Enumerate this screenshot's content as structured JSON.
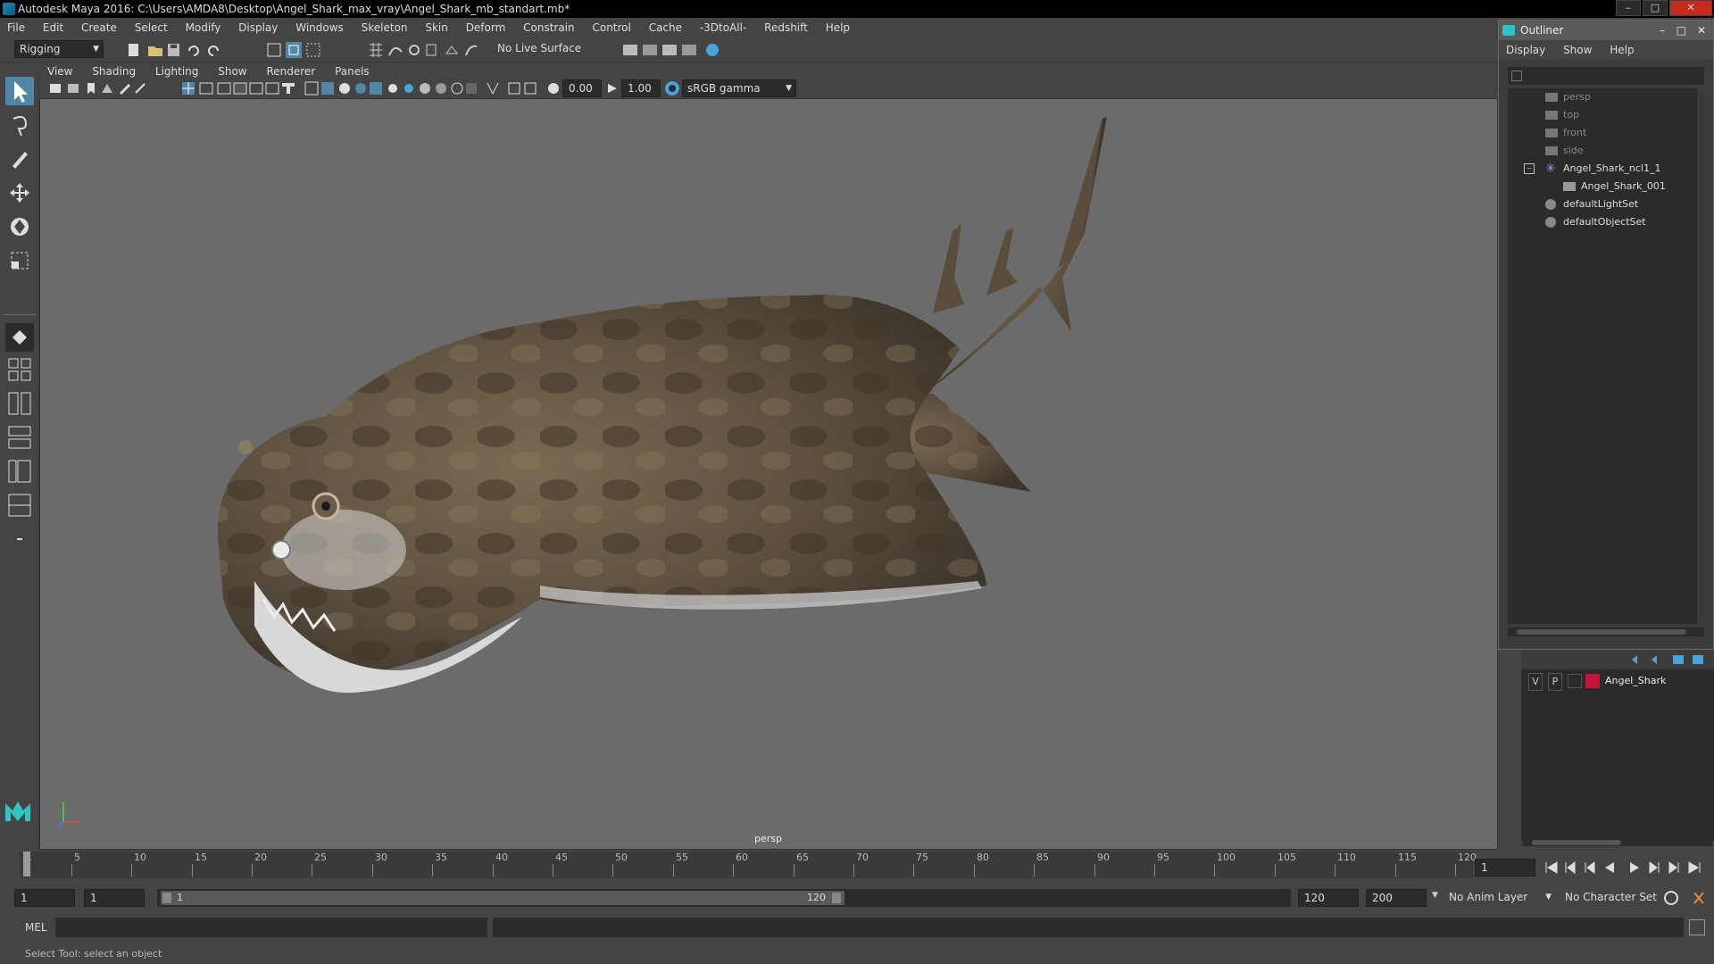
{
  "title_bar": {
    "text": "Autodesk Maya 2016: C:\\Users\\AMDA8\\Desktop\\Angel_Shark_max_vray\\Angel_Shark_mb_standart.mb*",
    "minimize": "–",
    "maximize": "□",
    "close": "✕"
  },
  "menu": [
    "File",
    "Edit",
    "Create",
    "Select",
    "Modify",
    "Display",
    "Windows",
    "Skeleton",
    "Skin",
    "Deform",
    "Constrain",
    "Control",
    "Cache",
    "-3DtoAll-",
    "Redshift",
    "Help"
  ],
  "status_line": {
    "mode": "Rigging",
    "live_surface": "No Live Surface"
  },
  "viewport": {
    "menu": [
      "View",
      "Shading",
      "Lighting",
      "Show",
      "Renderer",
      "Panels"
    ],
    "exposure": "0.00",
    "gamma": "1.00",
    "color_space": "sRGB gamma",
    "camera_label": "persp"
  },
  "outliner": {
    "title": "Outliner",
    "menu": [
      "Display",
      "Show",
      "Help"
    ],
    "items": [
      {
        "label": "persp",
        "kind": "camera",
        "indent": 0
      },
      {
        "label": "top",
        "kind": "camera",
        "indent": 0
      },
      {
        "label": "front",
        "kind": "camera",
        "indent": 0
      },
      {
        "label": "side",
        "kind": "camera",
        "indent": 0
      },
      {
        "label": "Angel_Shark_ncl1_1",
        "kind": "cluster",
        "indent": 0
      },
      {
        "label": "Angel_Shark_001",
        "kind": "mesh",
        "indent": 1
      },
      {
        "label": "defaultLightSet",
        "kind": "set",
        "indent": 0
      },
      {
        "label": "defaultObjectSet",
        "kind": "set",
        "indent": 0
      }
    ]
  },
  "layers": {
    "rows": [
      {
        "v": "V",
        "p": "P",
        "name": "Angel_Shark",
        "color": "#c8143c"
      }
    ]
  },
  "timeline": {
    "ticks": [
      "1",
      "5",
      "10",
      "15",
      "20",
      "25",
      "30",
      "35",
      "40",
      "45",
      "50",
      "55",
      "60",
      "65",
      "70",
      "75",
      "80",
      "85",
      "90",
      "95",
      "100",
      "105",
      "110",
      "115",
      "120"
    ],
    "current_frame": "1"
  },
  "range": {
    "start": "1",
    "anim_start": "1",
    "range_start_label": "1",
    "range_end_label": "120",
    "range_end": "120",
    "anim_end": "200",
    "anim_layer": "No Anim Layer",
    "character_set": "No Character Set"
  },
  "command": {
    "label": "MEL"
  },
  "help_line": "Select Tool: select an object",
  "colors": {
    "bg": "#444444",
    "viewport_bg": "#6b6b6b",
    "accent": "#5285a6",
    "layer_color": "#c8143c"
  }
}
